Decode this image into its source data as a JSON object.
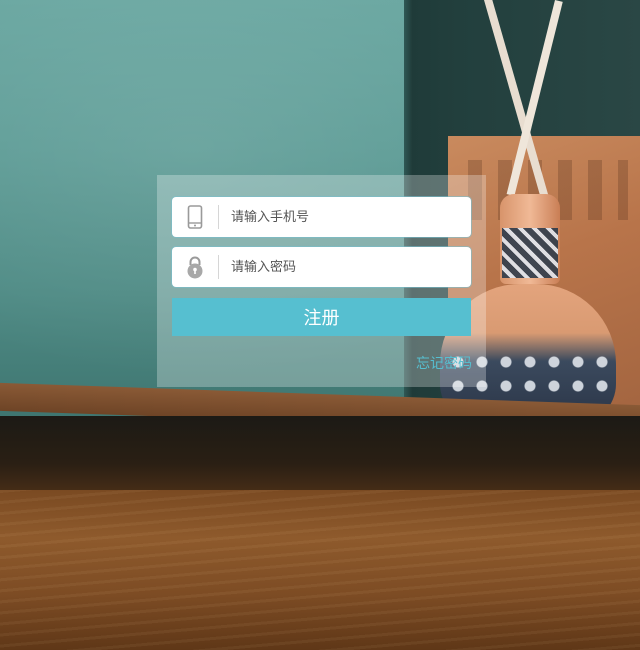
{
  "login": {
    "phone_placeholder": "请输入手机号",
    "password_placeholder": "请输入密码",
    "submit_label": "注册",
    "forgot_label": "忘记密码",
    "icons": {
      "phone": "phone-icon",
      "password": "lock-icon"
    }
  },
  "colors": {
    "accent": "#56bfd0",
    "panel_overlay": "rgba(255,255,255,0.28)",
    "icon_gray": "#9a9a9a"
  }
}
